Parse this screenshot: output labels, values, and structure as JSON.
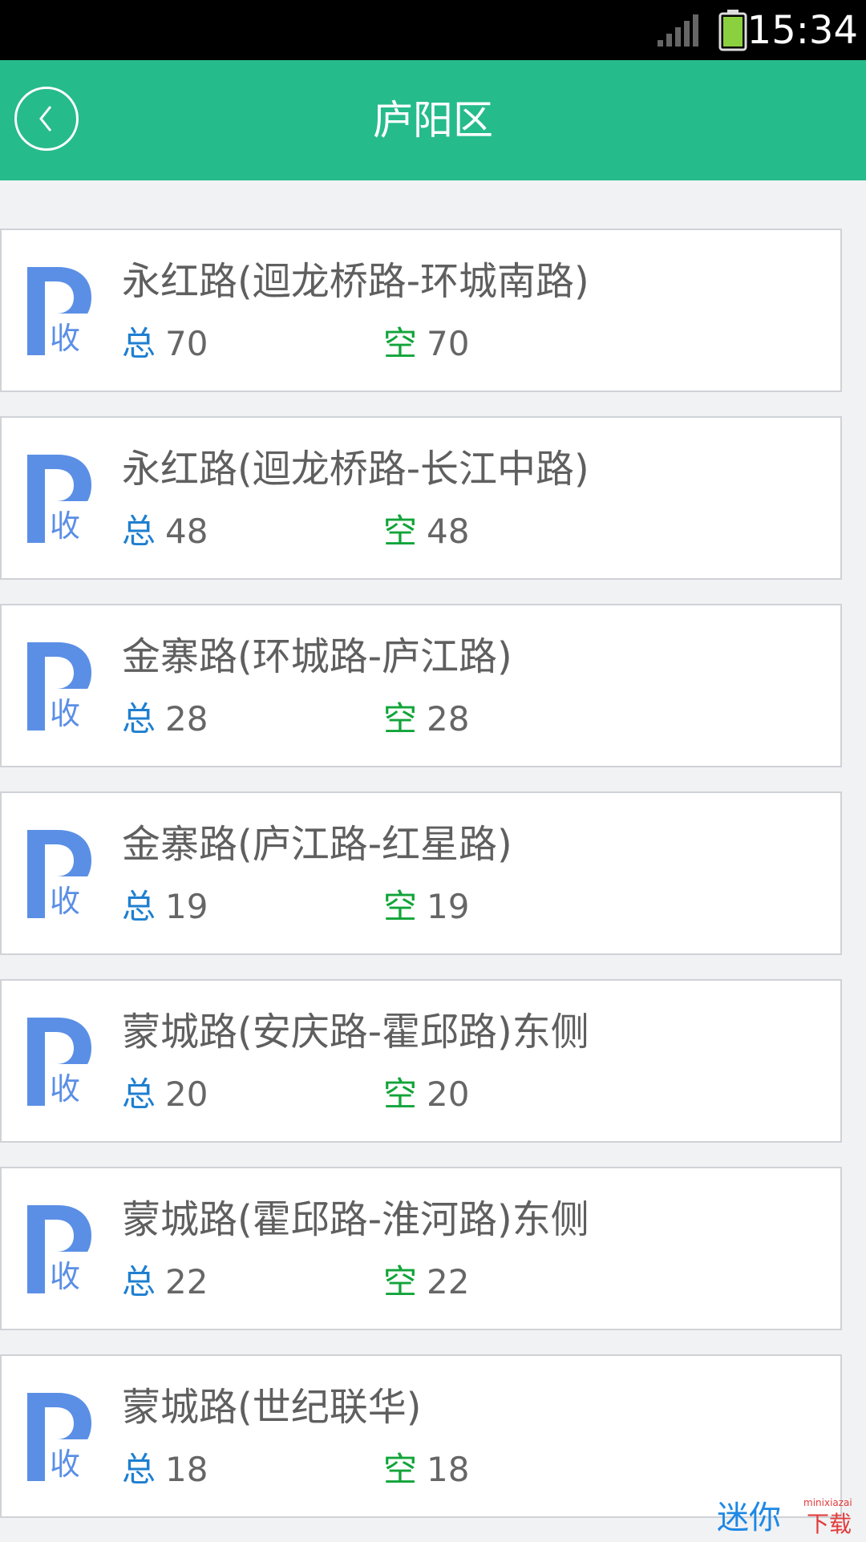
{
  "status_bar": {
    "time": "15:34"
  },
  "header": {
    "title": "庐阳区"
  },
  "stat_labels": {
    "total": "总",
    "empty": "空"
  },
  "icon_badge": "收",
  "items": [
    {
      "name": "永红路(迴龙桥路-环城南路)",
      "total": "70",
      "empty": "70"
    },
    {
      "name": "永红路(迴龙桥路-长江中路)",
      "total": "48",
      "empty": "48"
    },
    {
      "name": "金寨路(环城路-庐江路)",
      "total": "28",
      "empty": "28"
    },
    {
      "name": "金寨路(庐江路-红星路)",
      "total": "19",
      "empty": "19"
    },
    {
      "name": "蒙城路(安庆路-霍邱路)东侧",
      "total": "20",
      "empty": "20"
    },
    {
      "name": "蒙城路(霍邱路-淮河路)东侧",
      "total": "22",
      "empty": "22"
    },
    {
      "name": "蒙城路(世纪联华)",
      "total": "18",
      "empty": "18"
    }
  ],
  "watermark": {
    "text": "迷你下载",
    "subtext": "minixiazai"
  },
  "colors": {
    "app_bar": "#26bb8b",
    "total_label": "#1e7fd0",
    "empty_label": "#12a43a",
    "parking_icon": "#5b8fe6"
  }
}
